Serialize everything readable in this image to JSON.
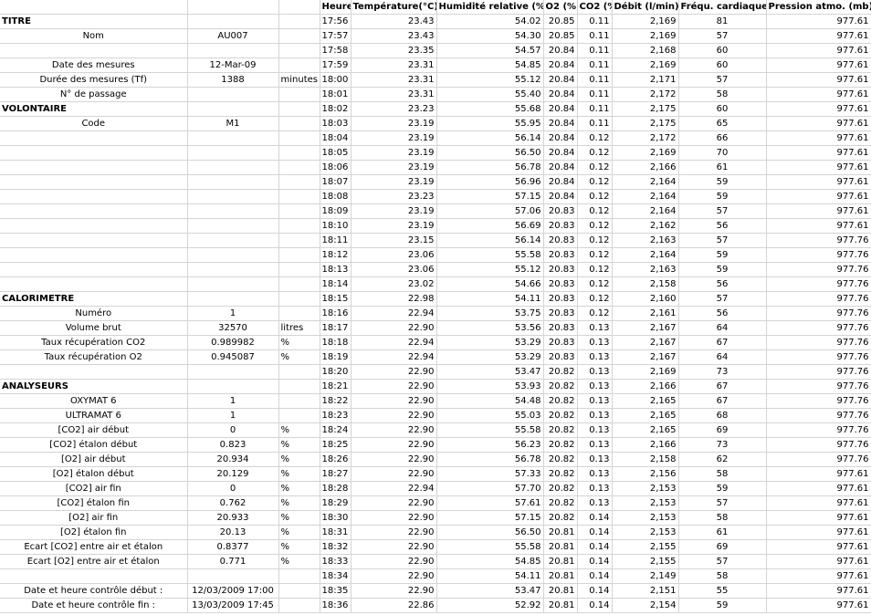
{
  "headers": [
    "Heure",
    "Température(°C)",
    "Humidité relative (%)",
    "O2 (%)",
    "CO2 (%)",
    "Débit (l/min)",
    "Fréqu. cardiaque",
    "Pression atmo. (mb)"
  ],
  "left": [
    [
      "",
      "",
      ""
    ],
    [
      "TITRE",
      "",
      ""
    ],
    [
      "Nom",
      "AU007",
      ""
    ],
    [
      "",
      "",
      ""
    ],
    [
      "Date des mesures",
      "12-Mar-09",
      ""
    ],
    [
      "Durée des mesures (Tf)",
      "1388",
      "minutes"
    ],
    [
      "N° de passage",
      "",
      ""
    ],
    [
      "VOLONTAIRE",
      "",
      ""
    ],
    [
      "Code",
      "M1",
      ""
    ],
    [
      "",
      "",
      ""
    ],
    [
      "",
      "",
      ""
    ],
    [
      "",
      "",
      ""
    ],
    [
      "",
      "",
      ""
    ],
    [
      "",
      "",
      ""
    ],
    [
      "",
      "",
      ""
    ],
    [
      "",
      "",
      ""
    ],
    [
      "",
      "",
      ""
    ],
    [
      "",
      "",
      ""
    ],
    [
      "",
      "",
      ""
    ],
    [
      "",
      "",
      ""
    ],
    [
      "CALORIMETRE",
      "",
      ""
    ],
    [
      "Numéro",
      "1",
      ""
    ],
    [
      "Volume brut",
      "32570",
      "litres"
    ],
    [
      "Taux récupération CO2",
      "0.989982",
      "%"
    ],
    [
      "Taux récupération O2",
      "0.945087",
      "%"
    ],
    [
      "",
      "",
      ""
    ],
    [
      "ANALYSEURS",
      "",
      ""
    ],
    [
      "OXYMAT 6",
      "1",
      ""
    ],
    [
      "ULTRAMAT 6",
      "1",
      ""
    ],
    [
      "[CO2] air début",
      "0",
      "%"
    ],
    [
      "[CO2] étalon début",
      "0.823",
      "%"
    ],
    [
      "[O2] air début",
      "20.934",
      "%"
    ],
    [
      "[O2] étalon début",
      "20.129",
      "%"
    ],
    [
      "[CO2] air fin",
      "0",
      "%"
    ],
    [
      "[CO2] étalon fin",
      "0.762",
      "%"
    ],
    [
      "[O2] air fin",
      "20.933",
      "%"
    ],
    [
      "[O2] étalon fin",
      "20.13",
      "%"
    ],
    [
      "Ecart [CO2] entre air et étalon",
      "0.8377",
      "%"
    ],
    [
      "Ecart [O2] entre air et étalon",
      "0.771",
      "%"
    ],
    [
      "",
      "",
      ""
    ],
    [
      "Date et heure contrôle début :",
      "12/03/2009 17:00",
      ""
    ],
    [
      "Date et heure contrôle fin :",
      "13/03/2009 17:45",
      ""
    ]
  ],
  "rows": [
    [
      "17:56",
      "23.43",
      "54.02",
      "20.85",
      "0.11",
      "2,169",
      "81",
      "977.61"
    ],
    [
      "17:57",
      "23.43",
      "54.30",
      "20.85",
      "0.11",
      "2,169",
      "57",
      "977.61"
    ],
    [
      "17:58",
      "23.35",
      "54.57",
      "20.84",
      "0.11",
      "2,168",
      "60",
      "977.61"
    ],
    [
      "17:59",
      "23.31",
      "54.85",
      "20.84",
      "0.11",
      "2,169",
      "60",
      "977.61"
    ],
    [
      "18:00",
      "23.31",
      "55.12",
      "20.84",
      "0.11",
      "2,171",
      "57",
      "977.61"
    ],
    [
      "18:01",
      "23.31",
      "55.40",
      "20.84",
      "0.11",
      "2,172",
      "58",
      "977.61"
    ],
    [
      "18:02",
      "23.23",
      "55.68",
      "20.84",
      "0.11",
      "2,175",
      "60",
      "977.61"
    ],
    [
      "18:03",
      "23.19",
      "55.95",
      "20.84",
      "0.11",
      "2,175",
      "65",
      "977.61"
    ],
    [
      "18:04",
      "23.19",
      "56.14",
      "20.84",
      "0.12",
      "2,172",
      "66",
      "977.61"
    ],
    [
      "18:05",
      "23.19",
      "56.50",
      "20.84",
      "0.12",
      "2,169",
      "70",
      "977.61"
    ],
    [
      "18:06",
      "23.19",
      "56.78",
      "20.84",
      "0.12",
      "2,166",
      "61",
      "977.61"
    ],
    [
      "18:07",
      "23.19",
      "56.96",
      "20.84",
      "0.12",
      "2,164",
      "59",
      "977.61"
    ],
    [
      "18:08",
      "23.23",
      "57.15",
      "20.84",
      "0.12",
      "2,164",
      "59",
      "977.61"
    ],
    [
      "18:09",
      "23.19",
      "57.06",
      "20.83",
      "0.12",
      "2,164",
      "57",
      "977.61"
    ],
    [
      "18:10",
      "23.19",
      "56.69",
      "20.83",
      "0.12",
      "2,162",
      "56",
      "977.61"
    ],
    [
      "18:11",
      "23.15",
      "56.14",
      "20.83",
      "0.12",
      "2,163",
      "57",
      "977.76"
    ],
    [
      "18:12",
      "23.06",
      "55.58",
      "20.83",
      "0.12",
      "2,164",
      "59",
      "977.76"
    ],
    [
      "18:13",
      "23.06",
      "55.12",
      "20.83",
      "0.12",
      "2,163",
      "59",
      "977.76"
    ],
    [
      "18:14",
      "23.02",
      "54.66",
      "20.83",
      "0.12",
      "2,158",
      "56",
      "977.76"
    ],
    [
      "18:15",
      "22.98",
      "54.11",
      "20.83",
      "0.12",
      "2,160",
      "57",
      "977.76"
    ],
    [
      "18:16",
      "22.94",
      "53.75",
      "20.83",
      "0.12",
      "2,161",
      "56",
      "977.76"
    ],
    [
      "18:17",
      "22.90",
      "53.56",
      "20.83",
      "0.13",
      "2,167",
      "64",
      "977.76"
    ],
    [
      "18:18",
      "22.94",
      "53.29",
      "20.83",
      "0.13",
      "2,167",
      "67",
      "977.76"
    ],
    [
      "18:19",
      "22.94",
      "53.29",
      "20.83",
      "0.13",
      "2,167",
      "64",
      "977.76"
    ],
    [
      "18:20",
      "22.90",
      "53.47",
      "20.82",
      "0.13",
      "2,169",
      "73",
      "977.76"
    ],
    [
      "18:21",
      "22.90",
      "53.93",
      "20.82",
      "0.13",
      "2,166",
      "67",
      "977.76"
    ],
    [
      "18:22",
      "22.90",
      "54.48",
      "20.82",
      "0.13",
      "2,165",
      "67",
      "977.76"
    ],
    [
      "18:23",
      "22.90",
      "55.03",
      "20.82",
      "0.13",
      "2,165",
      "68",
      "977.76"
    ],
    [
      "18:24",
      "22.90",
      "55.58",
      "20.82",
      "0.13",
      "2,165",
      "69",
      "977.76"
    ],
    [
      "18:25",
      "22.90",
      "56.23",
      "20.82",
      "0.13",
      "2,166",
      "73",
      "977.76"
    ],
    [
      "18:26",
      "22.90",
      "56.78",
      "20.82",
      "0.13",
      "2,158",
      "62",
      "977.76"
    ],
    [
      "18:27",
      "22.90",
      "57.33",
      "20.82",
      "0.13",
      "2,156",
      "58",
      "977.61"
    ],
    [
      "18:28",
      "22.94",
      "57.70",
      "20.82",
      "0.13",
      "2,153",
      "59",
      "977.61"
    ],
    [
      "18:29",
      "22.90",
      "57.61",
      "20.82",
      "0.13",
      "2,153",
      "57",
      "977.61"
    ],
    [
      "18:30",
      "22.90",
      "57.15",
      "20.82",
      "0.14",
      "2,153",
      "58",
      "977.61"
    ],
    [
      "18:31",
      "22.90",
      "56.50",
      "20.81",
      "0.14",
      "2,153",
      "61",
      "977.61"
    ],
    [
      "18:32",
      "22.90",
      "55.58",
      "20.81",
      "0.14",
      "2,155",
      "69",
      "977.61"
    ],
    [
      "18:33",
      "22.90",
      "54.85",
      "20.81",
      "0.14",
      "2,155",
      "57",
      "977.61"
    ],
    [
      "18:34",
      "22.90",
      "54.11",
      "20.81",
      "0.14",
      "2,149",
      "58",
      "977.61"
    ],
    [
      "18:35",
      "22.90",
      "53.47",
      "20.81",
      "0.14",
      "2,151",
      "55",
      "977.61"
    ],
    [
      "18:36",
      "22.86",
      "52.92",
      "20.81",
      "0.14",
      "2,154",
      "59",
      "977.61"
    ]
  ]
}
